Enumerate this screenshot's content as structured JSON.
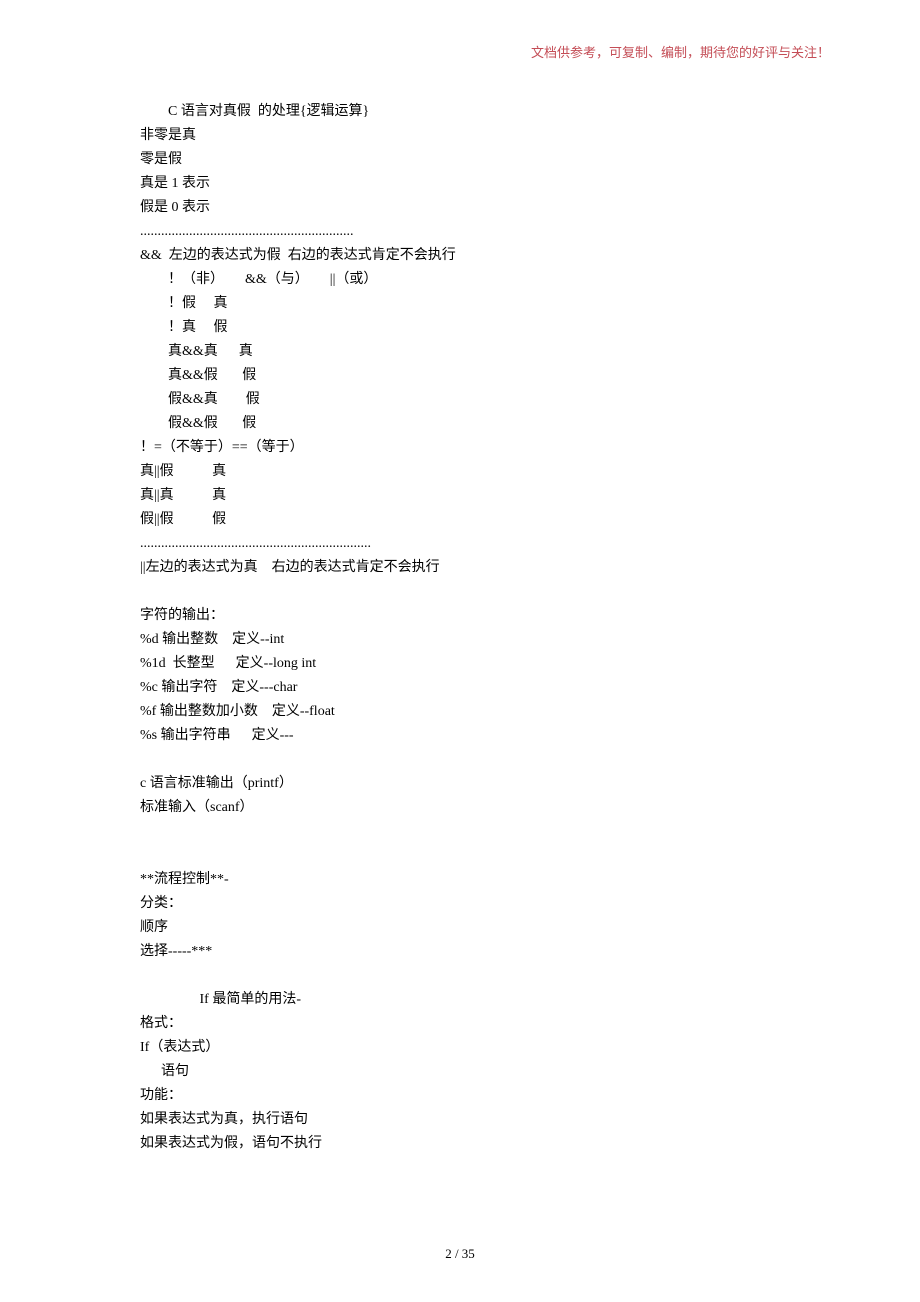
{
  "header": {
    "note": "文档供参考，可复制、编制，期待您的好评与关注！"
  },
  "body": {
    "l1": "C 语言对真假  的处理{逻辑运算}",
    "l2": "非零是真",
    "l3": "零是假",
    "l4": "真是 1 表示",
    "l5": "假是 0 表示",
    "l6": ".............................................................",
    "l7": "&&  左边的表达式为假  右边的表达式肯定不会执行",
    "l8": "！（非）      &&（与）      ||（或）",
    "l9": "！假     真",
    "l10": "！真     假",
    "l11": "真&&真      真",
    "l12": "真&&假       假",
    "l13": "假&&真        假",
    "l14": "假&&假       假",
    "l15": "！=（不等于）==（等于）",
    "l16": "真||假           真",
    "l17": "真||真           真",
    "l18": "假||假           假",
    "l19": "..................................................................",
    "l20": "||左边的表达式为真    右边的表达式肯定不会执行",
    "blank1": "",
    "l21": "字符的输出：",
    "l22": "%d 输出整数    定义--int",
    "l23": "%1d  长整型      定义--long int",
    "l24": "%c 输出字符    定义---char",
    "l25": "%f 输出整数加小数    定义--float",
    "l26": "%s 输出字符串      定义---",
    "blank2": "",
    "l27": "c 语言标准输出（printf）",
    "l28": "标准输入（scanf）",
    "blank3": "",
    "blank4": "",
    "l29": "**流程控制**-",
    "l30": "分类：",
    "l31": "顺序",
    "l32": "选择-----***",
    "blank5": "",
    "l33": "                 If 最简单的用法-",
    "l34": "格式：",
    "l35": "If（表达式）",
    "l36": "      语句",
    "l37": "功能：",
    "l38": "如果表达式为真，执行语句",
    "l39": "如果表达式为假，语句不执行"
  },
  "footer": {
    "page": "2  / 35"
  }
}
